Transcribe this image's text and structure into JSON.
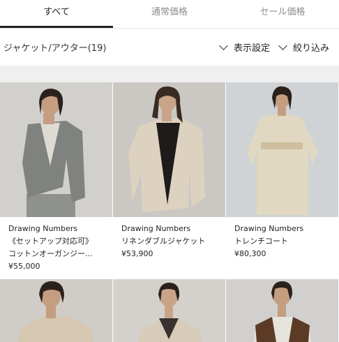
{
  "tabs": [
    {
      "label": "すべて",
      "active": true
    },
    {
      "label": "通常価格",
      "active": false
    },
    {
      "label": "セール価格",
      "active": false
    }
  ],
  "filter": {
    "category": "ジャケット/アウター(19)",
    "display_label": "表示設定",
    "narrow_label": "絞り込み"
  },
  "products": [
    {
      "brand": "Drawing Numbers",
      "name_line1": "《セットアップ対応可》",
      "name_line2": "コットンオーガンジー...",
      "price": "¥55,000"
    },
    {
      "brand": "Drawing Numbers",
      "name_line1": "リネンダブルジャケット",
      "name_line2": "",
      "price": "¥53,900"
    },
    {
      "brand": "Drawing Numbers",
      "name_line1": "トレンチコート",
      "name_line2": "",
      "price": "¥80,300"
    }
  ],
  "colors": {
    "accent": "#222222",
    "tab_inactive": "#8c8c8c",
    "divider": "#efefef"
  }
}
